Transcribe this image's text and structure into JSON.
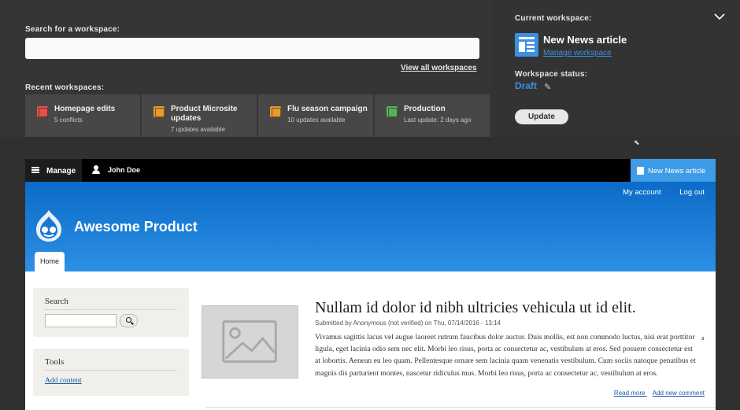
{
  "workspace_panel": {
    "search_label": "Search for a workspace:",
    "search_value": "",
    "view_all": "View all workspaces",
    "recent_label": "Recent workspaces:",
    "recent": [
      {
        "title": "Homepage edits",
        "subtitle": "5 conflicts",
        "icon": "calendar-red-icon",
        "color": "#e0534a"
      },
      {
        "title": "Product Microsite updates",
        "subtitle": "7 updates available",
        "icon": "calendar-orange-icon",
        "color": "#e89a2c"
      },
      {
        "title": "Flu season campaign",
        "subtitle": "10 updates available",
        "icon": "calendar-orange-icon",
        "color": "#e89a2c"
      },
      {
        "title": "Production",
        "subtitle": "Last update: 2 days ago",
        "icon": "calendar-green-icon",
        "color": "#5bb05b"
      }
    ],
    "current_label": "Current workspace:",
    "current_title": "New News article",
    "manage_link": "Manage workspace",
    "status_label": "Workspace status:",
    "status_value": "Draft",
    "update_button": "Update"
  },
  "toolbar": {
    "manage": "Manage",
    "user": "John Doe",
    "workspace": "New News article"
  },
  "header": {
    "my_account": "My account",
    "log_out": "Log out",
    "site_name": "Awesome Product",
    "home_tab": "Home"
  },
  "sidebar": {
    "search_title": "Search",
    "search_value": "",
    "tools_title": "Tools",
    "add_content": "Add content"
  },
  "article": {
    "title": "Nullam id dolor id nibh ultricies vehicula ut id elit.",
    "submitted": "Submitted by Anonymous (not verified) on Thu, 07/14/2016 - 13:14",
    "body": "Vivamus sagittis lacus vel augue laoreet rutrum faucibus dolor auctor. Duis mollis, est non commodo luctus, nisi erat porttitor ligula, eget lacinia odio sem nec elit. Morbi leo risus, porta ac consectetur ac, vestibulum at eros. Sed posuere consectetur est at lobortis. Aenean eu leo quam. Pellentesque ornare sem lacinia quam venenatis vestibulum. Cum sociis natoque penatibus et magnis dis parturient montes, nascetur ridiculus mus. Morbi leo risus, porta ac consectetur ac, vestibulum at eros.",
    "side_digit": "a",
    "read_more": "Read more",
    "add_comment": "Add new comment"
  },
  "colors": {
    "accent_blue": "#3d8fe0",
    "toolbar_workspace": "#3e9be8",
    "header_top": "#0b6bc7",
    "header_bottom": "#2d8fe5"
  }
}
